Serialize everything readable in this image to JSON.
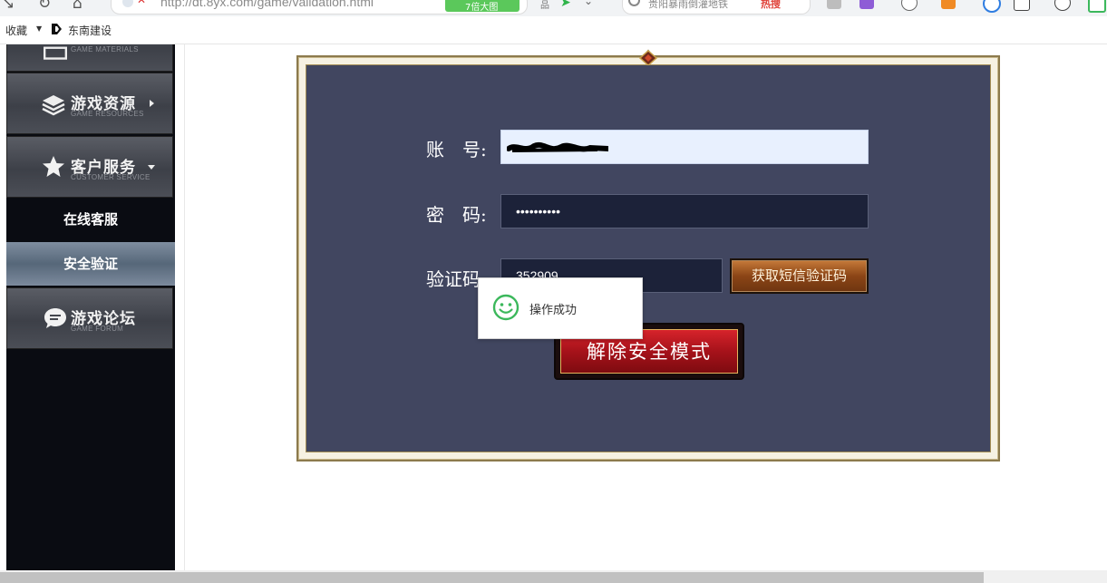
{
  "browser": {
    "url": "http://dt.8yx.com/game/validation.html",
    "url_badge": "7倍大图",
    "search_text": "贵阳暴雨倒灌地铁",
    "search_badge": "热搜",
    "bookmarks": {
      "favorites_label": "收藏",
      "site_label": "东南建设"
    }
  },
  "sidebar": {
    "items": [
      {
        "title": "",
        "subtitle": "GAME MATERIALS",
        "icon": "book-icon"
      },
      {
        "title": "游戏资源",
        "subtitle": "GAME RESOURCES",
        "icon": "layers-icon"
      },
      {
        "title": "客户服务",
        "subtitle": "CUSTOMER SERVICE",
        "icon": "star-icon"
      },
      {
        "title": "游戏论坛",
        "subtitle": "GAME FORUM",
        "icon": "chat-bubble-icon"
      }
    ],
    "sub_links": [
      {
        "label": "在线客服",
        "active": false
      },
      {
        "label": "安全验证",
        "active": true
      }
    ]
  },
  "form": {
    "account_label": "账　号:",
    "account_value": "",
    "password_label": "密　码:",
    "password_value": "••••••••••",
    "captcha_label": "验证码:",
    "captcha_value": "352909",
    "sms_button_label": "获取短信验证码",
    "submit_button_label": "解除安全模式"
  },
  "toast": {
    "message": "操作成功",
    "icon": "smiley-icon"
  },
  "colors": {
    "panel": "#414660",
    "field_dark": "#1c2239",
    "field_autofill": "#e8f0fe",
    "submit_red": "#b3151d",
    "sms_brown": "#8b4516",
    "toast_green": "#3cb85c"
  }
}
